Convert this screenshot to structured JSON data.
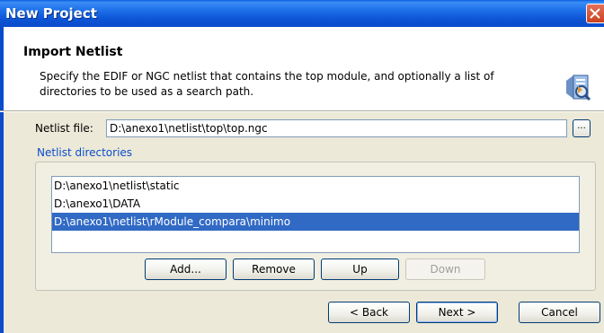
{
  "window": {
    "title": "New Project"
  },
  "header": {
    "title": "Import Netlist",
    "description": "Specify the EDIF or NGC netlist that contains the top module, and optionally a list of directories to be used as a search path."
  },
  "netlist": {
    "label": "Netlist file:",
    "value": "D:\\anexo1\\netlist\\top\\top.ngc",
    "browse_label": "..."
  },
  "directories": {
    "label": "Netlist directories",
    "items": [
      "D:\\anexo1\\netlist\\static",
      "D:\\anexo1\\DATA",
      "D:\\anexo1\\netlist\\rModule_compara\\minimo"
    ],
    "selected_index": 2,
    "buttons": {
      "add": "Add...",
      "remove": "Remove",
      "up": "Up",
      "down": "Down"
    }
  },
  "footer": {
    "back": "< Back",
    "next": "Next >",
    "cancel": "Cancel"
  }
}
